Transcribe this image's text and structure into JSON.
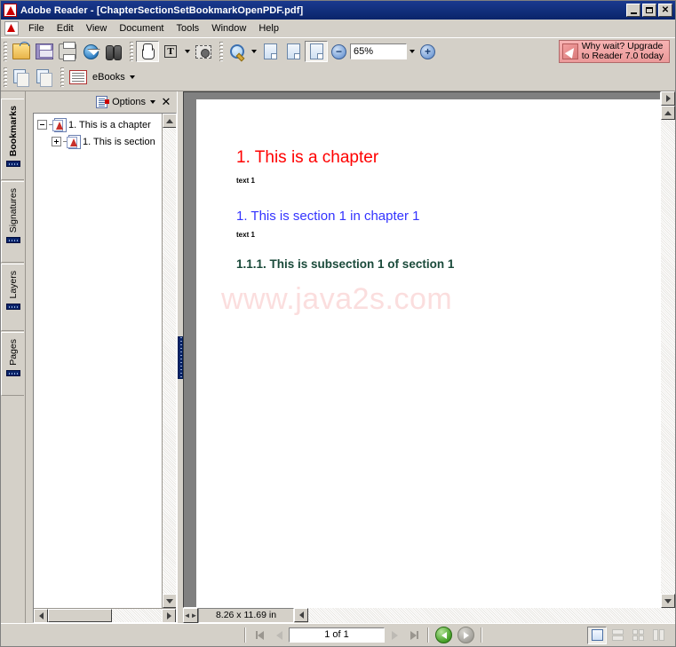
{
  "window": {
    "title": "Adobe Reader - [ChapterSectionSetBookmarkOpenPDF.pdf]",
    "app_icon": "adobe-reader-icon",
    "minimize": "_",
    "maximize": "□",
    "close": "✕"
  },
  "menubar": {
    "items": [
      {
        "label": "File"
      },
      {
        "label": "Edit"
      },
      {
        "label": "View"
      },
      {
        "label": "Document"
      },
      {
        "label": "Tools"
      },
      {
        "label": "Window"
      },
      {
        "label": "Help"
      }
    ]
  },
  "toolbar": {
    "file_group": [
      {
        "name": "open-file-button",
        "icon": "open-folder-icon",
        "tooltip": "Open"
      },
      {
        "name": "save-button",
        "icon": "save-floppy-icon",
        "tooltip": "Save a Copy"
      },
      {
        "name": "print-button",
        "icon": "printer-icon",
        "tooltip": "Print"
      },
      {
        "name": "email-button",
        "icon": "globe-email-icon",
        "tooltip": "Email"
      },
      {
        "name": "search-button",
        "icon": "binoculars-icon",
        "tooltip": "Search"
      }
    ],
    "tools_group": [
      {
        "name": "hand-tool-button",
        "icon": "hand-icon",
        "active": true
      },
      {
        "name": "select-text-tool-button",
        "icon": "text-select-icon",
        "label": "T",
        "has_dropdown": true
      },
      {
        "name": "snapshot-tool-button",
        "icon": "snapshot-camera-icon"
      }
    ],
    "zoom_group": [
      {
        "name": "zoom-tool-button",
        "icon": "magnifier-icon",
        "has_dropdown": true
      },
      {
        "name": "actual-size-button",
        "icon": "page-actual-size-icon"
      },
      {
        "name": "fit-page-button",
        "icon": "page-fit-icon"
      },
      {
        "name": "fit-width-button",
        "icon": "page-fit-width-icon",
        "active": true
      }
    ],
    "zoom_out_icon": "minus-circle-icon",
    "zoom_out_glyph": "−",
    "zoom_value": "65%",
    "zoom_in_icon": "plus-circle-icon",
    "zoom_in_glyph": "+",
    "upgrade_banner": {
      "icon": "upgrade-arrow-icon",
      "line1": "Why wait? Upgrade",
      "line2": "to Reader 7.0 today"
    }
  },
  "toolbar_row2": {
    "nav_group": [
      {
        "name": "previous-view-button",
        "icon": "previous-view-icon"
      },
      {
        "name": "next-view-button",
        "icon": "next-view-icon"
      }
    ],
    "ebooks": {
      "icon": "ebooks-icon",
      "label": "eBooks",
      "has_dropdown": true
    }
  },
  "sidebar": {
    "tabs": [
      {
        "label": "Bookmarks",
        "active": true,
        "name": "sidebar-tab-bookmarks"
      },
      {
        "label": "Signatures",
        "active": false,
        "name": "sidebar-tab-signatures"
      },
      {
        "label": "Layers",
        "active": false,
        "name": "sidebar-tab-layers"
      },
      {
        "label": "Pages",
        "active": false,
        "name": "sidebar-tab-pages"
      }
    ],
    "panel": {
      "options_icon": "bookmark-options-icon",
      "options_label": "Options",
      "close_glyph": "✕",
      "bookmarks": [
        {
          "label": "1. This is a chapter",
          "expanded": true,
          "expander": "minus",
          "level": 0
        },
        {
          "label": "1. This is section",
          "expanded": false,
          "expander": "plus",
          "level": 1
        }
      ]
    }
  },
  "document": {
    "chapter_heading": "1. This is a chapter",
    "chapter_text": "text 1",
    "section_heading": "1. This is section 1 in chapter 1",
    "section_text": "text 1",
    "subsection_heading": "1.1.1. This is subsection 1 of section 1",
    "watermark": "www.java2s.com",
    "colors": {
      "chapter": "#ff0000",
      "section": "#3333ff",
      "subsection": "#1a4a3a",
      "watermark": "#fbdede"
    },
    "page_size": "8.26 x 11.69 in"
  },
  "statusbar": {
    "first_page_button": "first-page-icon",
    "prev_page_button": "previous-page-icon",
    "page_value": "1 of 1",
    "next_page_button": "next-page-icon",
    "last_page_button": "last-page-icon",
    "back_button": "go-back-icon",
    "forward_button": "go-forward-icon",
    "layout_buttons": [
      {
        "name": "single-page-layout-button",
        "active": true
      },
      {
        "name": "continuous-layout-button",
        "active": false
      },
      {
        "name": "facing-layout-button",
        "active": false
      },
      {
        "name": "continuous-facing-layout-button",
        "active": false
      }
    ]
  }
}
